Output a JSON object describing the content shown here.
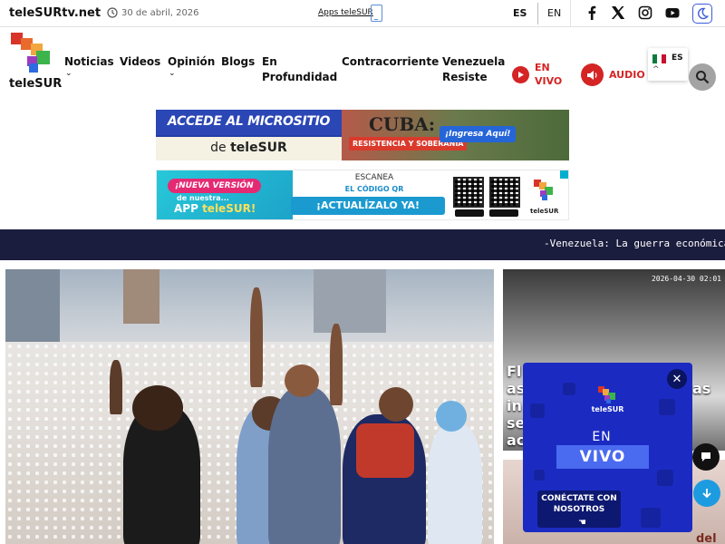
{
  "topbar": {
    "site_name": "teleSURtv.net",
    "date": "30 de abril, 2026",
    "apps_link": "Apps teleSUR",
    "lang_es": "ES",
    "lang_en": "EN"
  },
  "header": {
    "logo_text": "teleSUR",
    "nav": {
      "noticias": "Noticias",
      "videos": "Videos",
      "opinion": "Opinión",
      "blogs": "Blogs",
      "en_profundidad": "En Profundidad",
      "contracorriente": "Contracorriente",
      "venezuela_resiste": "Venezuela Resiste"
    },
    "live_label": "EN VIVO",
    "audio_label": "AUDIO",
    "lang_select": "ES"
  },
  "banner_microsite": {
    "headline": "ACCEDE AL MICROSITIO",
    "sub_prefix": "de ",
    "sub_brand": "teleSUR",
    "cuba": "CUBA:",
    "tag": "RESISTENCIA Y SOBERANÍA",
    "cta": "¡Ingresa Aquí!"
  },
  "banner_app": {
    "pill": "¡NUEVA VERSIÓN",
    "small": "de nuestra...",
    "app_prefix": "APP ",
    "app_brand": "teleSUR!",
    "scan": "ESCANEA",
    "scan2": "EL CÓDIGO QR",
    "update": "¡ACTUALÍZALO YA!",
    "logo_text": "teleSUR"
  },
  "ticker": {
    "text": "-Venezuela: La guerra económica del"
  },
  "side_story": {
    "date": "2026-04-30 02:01",
    "headline_lines": [
      "Fl",
      "as",
      "in",
      "se",
      "ac"
    ],
    "headline_suffix": "as"
  },
  "side_story2": {
    "text": "del P"
  },
  "live_popup": {
    "close": "✕",
    "logo_text": "teleSUR",
    "en": "EN",
    "vivo": "VIVO",
    "cta": "CONÉCTATE CON NOSOTROS"
  },
  "colors": {
    "accent_red": "#d42424",
    "ticker_bg": "#1b1d3e",
    "popup_blue": "#1b2bc2"
  },
  "icons": {
    "clock": "clock-icon",
    "phone": "phone-icon",
    "facebook": "facebook-icon",
    "x": "x-icon",
    "instagram": "instagram-icon",
    "youtube": "youtube-icon",
    "moon": "moon-icon",
    "search": "search-icon"
  }
}
